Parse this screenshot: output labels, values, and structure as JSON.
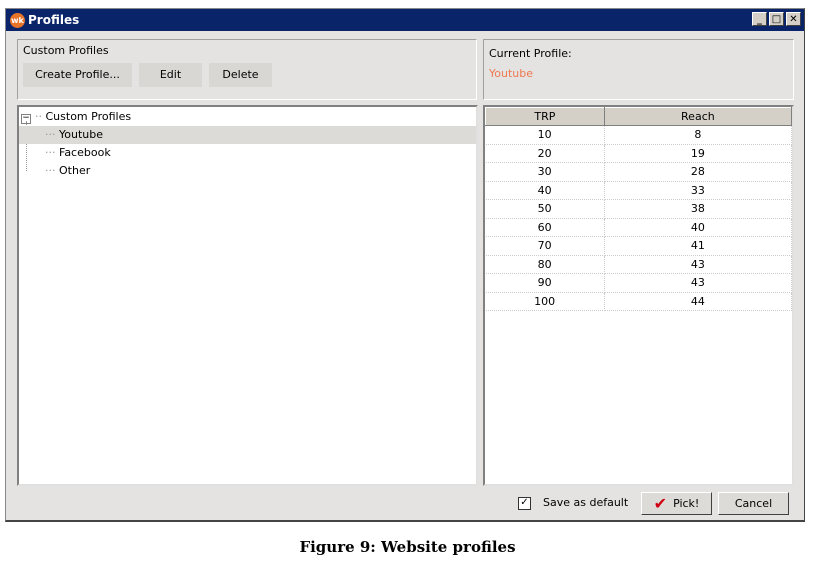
{
  "window": {
    "title": "Profiles",
    "logo": "wk",
    "min": "_",
    "max": "□",
    "close": "✕"
  },
  "profiles_panel": {
    "label": "Custom Profiles",
    "create_label": "Create Profile...",
    "edit_label": "Edit",
    "delete_label": "Delete"
  },
  "current": {
    "label": "Current Profile:",
    "value": "Youtube",
    "value_color": "#f07850"
  },
  "tree": {
    "root": "Custom Profiles",
    "children": [
      "Youtube",
      "Facebook",
      "Other"
    ],
    "selected": "Youtube"
  },
  "table": {
    "headers": [
      "TRP",
      "Reach"
    ],
    "rows": [
      [
        "10",
        "8"
      ],
      [
        "20",
        "19"
      ],
      [
        "30",
        "28"
      ],
      [
        "40",
        "33"
      ],
      [
        "50",
        "38"
      ],
      [
        "60",
        "40"
      ],
      [
        "70",
        "41"
      ],
      [
        "80",
        "43"
      ],
      [
        "90",
        "43"
      ],
      [
        "100",
        "44"
      ]
    ]
  },
  "footer": {
    "save_default_label": "Save as default",
    "save_default_checked": true,
    "pick_label": "Pick!",
    "cancel_label": "Cancel"
  },
  "caption": "Figure 9: Website profiles"
}
